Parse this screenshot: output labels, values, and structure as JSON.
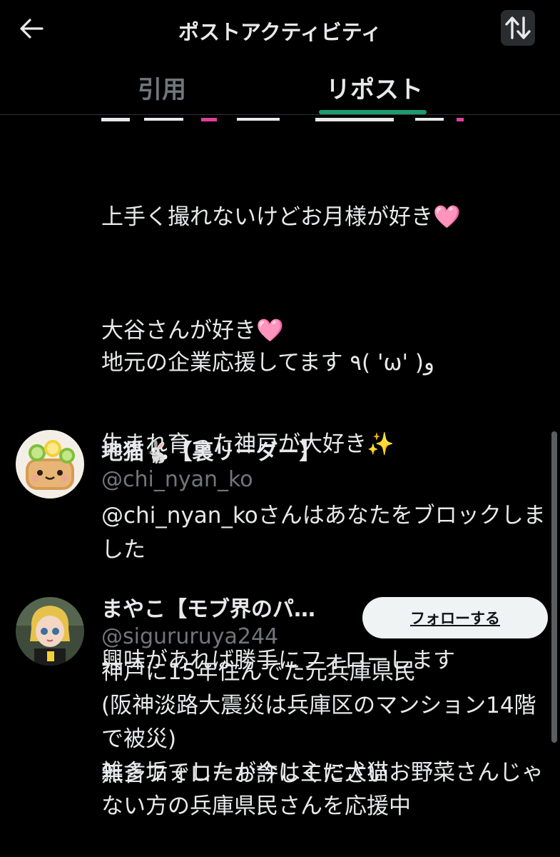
{
  "header": {
    "title": "ポストアクティビティ",
    "back_icon": "arrow-left-icon",
    "sort_icon": "sort-arrows-icon"
  },
  "tabs": {
    "quote_label": "引用",
    "repost_label": "リポスト",
    "active": "repost",
    "indicator_color": "#1d9b6f"
  },
  "bio_lines": [
    "上手く撮れないけどお月様が好き🩷",
    "大谷さんが好き🩷",
    "生まれ育った神戸が大好き✨",
    "",
    "興味があれば勝手にフォローします",
    "無言フォローお許しください"
  ],
  "bio_last_line": "地元の企業応援してます ٩( 'ω' )و",
  "users": [
    {
      "name": "地猫🐇【裏リーダー】",
      "handle": "@chi_nyan_ko",
      "description": "@chi_nyan_koさんはあなたをブロックしました",
      "avatar_icon": "cat-bowl-avatar-icon"
    },
    {
      "name": "まやこ【モブ界のパ…",
      "handle": "@sigururuya244",
      "follow_label": "フォローする",
      "description": "神戸に15年住んでた元兵庫県民\n(阪神淡路大震災は兵庫区のマンション14階で被災)\n雑多垢でしたが今は主に犬猫お野菜さんじゃない方の兵庫県民さんを応援中",
      "avatar_icon": "doll-avatar-icon"
    }
  ]
}
